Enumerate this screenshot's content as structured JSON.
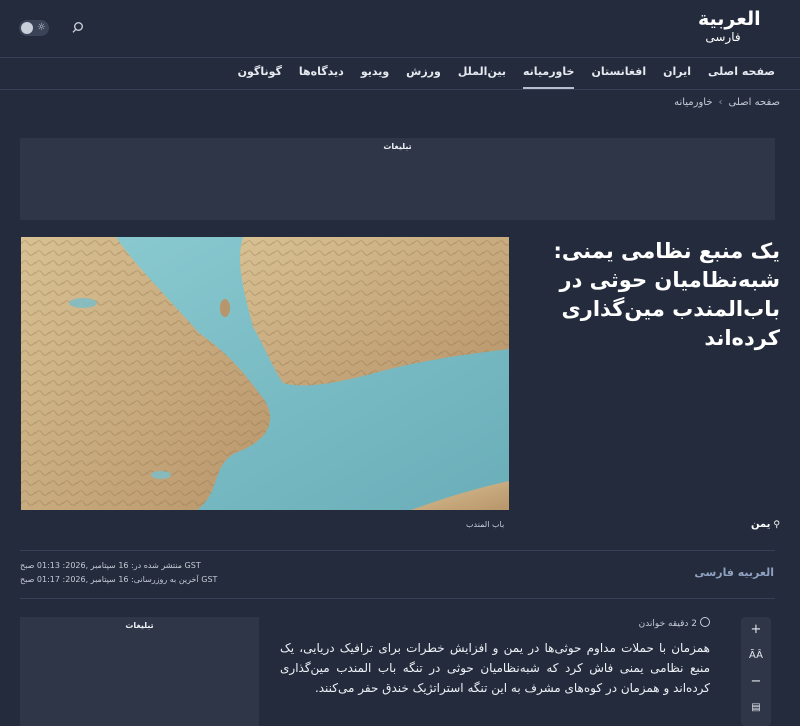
{
  "logo": {
    "line1": "العربية",
    "line2": "فارسی"
  },
  "nav": {
    "items": [
      {
        "label": "صفحه اصلی"
      },
      {
        "label": "ایران"
      },
      {
        "label": "افغانستان"
      },
      {
        "label": "خاورمیانه",
        "active": true
      },
      {
        "label": "بین‌الملل"
      },
      {
        "label": "ورزش"
      },
      {
        "label": "ویدیو"
      },
      {
        "label": "دیدگاه‌ها"
      },
      {
        "label": "گوناگون"
      }
    ]
  },
  "breadcrumb": {
    "home": "صفحه اصلی",
    "separator": "›",
    "current": "خاورمیانه"
  },
  "ad": {
    "label": "تبلیغات"
  },
  "article": {
    "title": "یک منبع نظامی یمنی: شبه‌نظامیان حوثی در باب‌المندب مین‌گذاری کرده‌اند",
    "image_caption": "باب المندب",
    "tag": "یمن",
    "published": "منتشر شده در: 16 سپتامبر ,2026: 01:13 صبح GST",
    "updated": "آخرین به روزرسانی: 16 سپتامبر ,2026: 01:17 صبح GST",
    "author": "العربیه فارسی",
    "read_time": "2 دقیقه خواندن",
    "body": "همزمان با حملات مداوم حوثی‌ها در یمن و افزایش خطرات برای ترافیک دریایی، یک منبع نظامی یمنی فاش کرد که شبه‌نظامیان حوثی در تنگه باب المندب مین‌گذاری کرده‌اند و همزمان در کوه‌های مشرف به این تنگه استراتژیک خندق حفر می‌کنند."
  },
  "toolbar": {
    "zoom_in": "+",
    "text_size": "ÃÂ",
    "zoom_out": "−",
    "print": "▤"
  },
  "colors": {
    "background": "#232b3c",
    "panel": "#2e3648",
    "divider": "#374056",
    "author": "#8fa0c0",
    "sea": "#7fbcc4",
    "land": "#c9ad7e"
  }
}
